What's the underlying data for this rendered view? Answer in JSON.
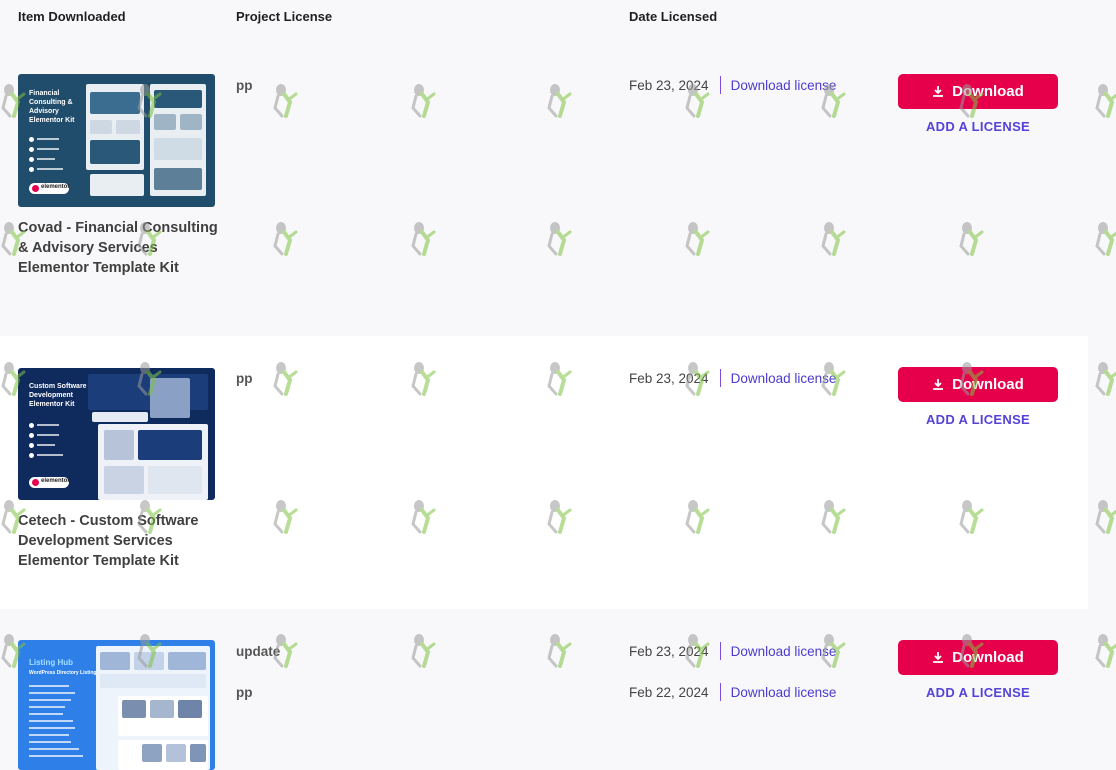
{
  "columns": {
    "item": "Item Downloaded",
    "project_license": "Project License",
    "date_licensed": "Date Licensed"
  },
  "rows": [
    {
      "title": "Covad - Financial Consulting & Advisory Services Elementor Template Kit",
      "thumb_heading": "Financial Consulting & Advisory Elementor Kit",
      "thumb_brand": "elementor",
      "licenses": [
        {
          "project": "pp",
          "date": "Feb 23, 2024",
          "link": "Download license"
        }
      ],
      "download_label": "Download",
      "add_license_label": "ADD A LICENSE"
    },
    {
      "title": "Cetech - Custom Software Development Services Elementor Template Kit",
      "thumb_heading": "Custom Software Development Elementor Kit",
      "thumb_brand": "elementor",
      "licenses": [
        {
          "project": "pp",
          "date": "Feb 23, 2024",
          "link": "Download license"
        }
      ],
      "download_label": "Download",
      "add_license_label": "ADD A LICENSE"
    },
    {
      "title": "",
      "thumb_heading": "Listing Hub",
      "thumb_sub": "WordPress Directory Listing",
      "licenses": [
        {
          "project": "update",
          "date": "Feb 23, 2024",
          "link": "Download license"
        },
        {
          "project": "pp",
          "date": "Feb 22, 2024",
          "link": "Download license"
        }
      ],
      "download_label": "Download",
      "add_license_label": "ADD A LICENSE"
    }
  ],
  "icons": {
    "download": "download-icon",
    "watermark": "watermark-figure-icon"
  },
  "colors": {
    "accent": "#e6004c",
    "link": "#4b3bd0",
    "add_license": "#5542d8",
    "thumb1": "#1f4d6b",
    "thumb2": "#0f2a5c",
    "thumb3": "#2f7fe8"
  }
}
